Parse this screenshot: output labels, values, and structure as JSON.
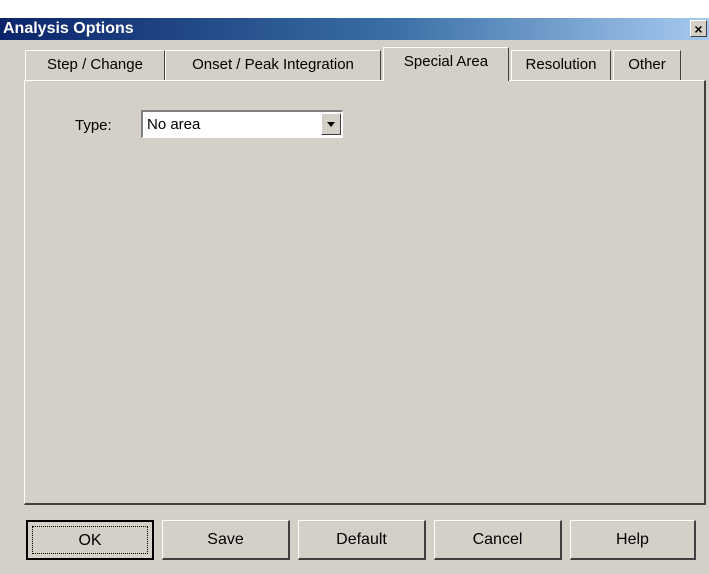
{
  "window": {
    "title": "Analysis Options",
    "close_glyph": "×"
  },
  "tabs": [
    {
      "label": "Step / Change",
      "active": false
    },
    {
      "label": "Onset / Peak Integration",
      "active": false
    },
    {
      "label": "Special Area",
      "active": true
    },
    {
      "label": "Resolution",
      "active": false
    },
    {
      "label": "Other",
      "active": false
    }
  ],
  "special_area": {
    "type_label": "Type:",
    "type_value": "No area"
  },
  "buttons": {
    "ok": "OK",
    "save": "Save",
    "default": "Default",
    "cancel": "Cancel",
    "help": "Help"
  },
  "icons": {
    "close": "close-icon",
    "dropdown": "chevron-down-icon"
  },
  "colors": {
    "face": "#d4d0c8",
    "title_start": "#0a246a",
    "title_end": "#a6caf0"
  }
}
